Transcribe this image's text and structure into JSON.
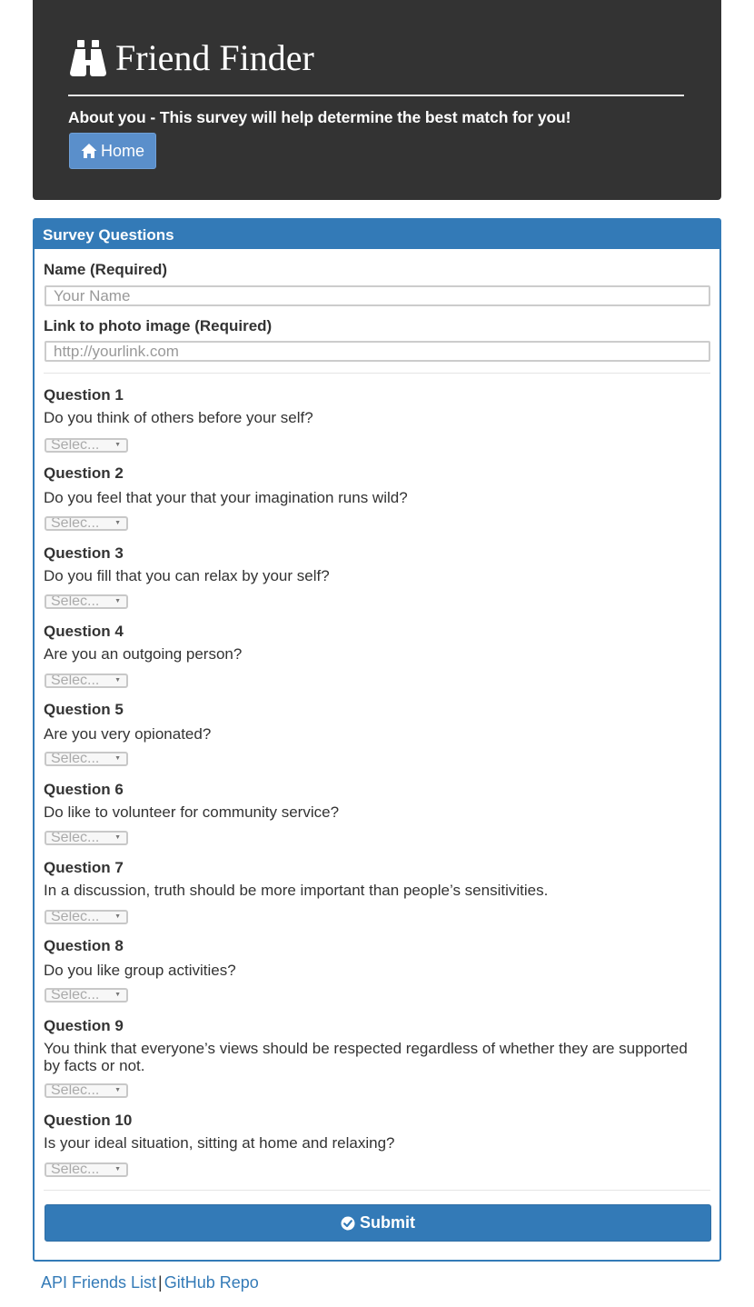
{
  "header": {
    "title": "Friend Finder",
    "lead": "About you - This survey will help determine the best match for you!",
    "home_label": "Home"
  },
  "panel": {
    "heading": "Survey Questions",
    "name_label": "Name (Required)",
    "name_placeholder": "Your Name",
    "photo_label": "Link to photo image (Required)",
    "photo_placeholder": "http://yourlink.com"
  },
  "questions": [
    {
      "label": "Question 1",
      "text": "Do you think of others before your self?",
      "selected": "Selec..."
    },
    {
      "label": "Question 2",
      "text": "Do you feel that your that your imagination runs wild?",
      "selected": "Selec..."
    },
    {
      "label": "Question 3",
      "text": "Do you fill that you can relax by your self?",
      "selected": "Selec..."
    },
    {
      "label": "Question 4",
      "text": "Are you an outgoing person?",
      "selected": "Selec..."
    },
    {
      "label": "Question 5",
      "text": "Are you very opionated?",
      "selected": "Selec..."
    },
    {
      "label": "Question 6",
      "text": "Do like to volunteer for community service?",
      "selected": "Selec..."
    },
    {
      "label": "Question 7",
      "text": "In a discussion, truth should be more important than people’s sensitivities.",
      "selected": "Selec..."
    },
    {
      "label": "Question 8",
      "text": "Do you like group activities?",
      "selected": "Selec..."
    },
    {
      "label": "Question 9",
      "text": "You think that everyone’s views should be respected regardless of whether they are supported by facts or not.",
      "selected": "Selec..."
    },
    {
      "label": "Question 10",
      "text": "Is your ideal situation, sitting at home and relaxing?",
      "selected": "Selec..."
    }
  ],
  "submit_label": "Submit",
  "footer": {
    "api_link": "API Friends List",
    "separator": "|",
    "github_link": "GitHub Repo"
  },
  "colors": {
    "header_bg": "#333333",
    "primary": "#337ab7",
    "home_button": "#5a8fcb"
  },
  "icons": {
    "brand": "binoculars-icon",
    "home": "home-icon",
    "submit": "check-circle-icon",
    "select": "caret-down-icon"
  }
}
